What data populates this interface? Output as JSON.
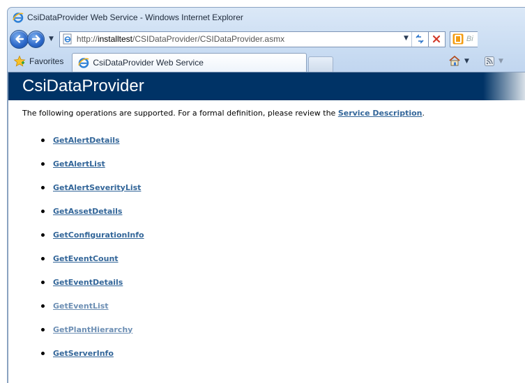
{
  "window": {
    "title": "CsiDataProvider Web Service - Windows Internet Explorer"
  },
  "address_bar": {
    "url_scheme": "http://",
    "url_host": "installtest",
    "url_path": "/CSIDataProvider/CSIDataProvider.asmx",
    "search_placeholder": "Bi"
  },
  "favorites_bar": {
    "favorites_label": "Favorites",
    "active_tab_label": "CsiDataProvider Web Service"
  },
  "page": {
    "title": "CsiDataProvider",
    "intro_text": "The following operations are supported. For a formal definition, please review the ",
    "service_description_link": "Service Description",
    "intro_suffix": ".",
    "operations": [
      {
        "name": "GetAlertDetails",
        "visited": false
      },
      {
        "name": "GetAlertList",
        "visited": false
      },
      {
        "name": "GetAlertSeverityList",
        "visited": false
      },
      {
        "name": "GetAssetDetails",
        "visited": false
      },
      {
        "name": "GetConfigurationInfo",
        "visited": false
      },
      {
        "name": "GetEventCount",
        "visited": false
      },
      {
        "name": "GetEventDetails",
        "visited": false
      },
      {
        "name": "GetEventList",
        "visited": true
      },
      {
        "name": "GetPlantHierarchy",
        "visited": true
      },
      {
        "name": "GetServerInfo",
        "visited": false
      }
    ]
  },
  "colors": {
    "header_band": "#003366",
    "link": "#336699",
    "visited_link": "#6d8fb4",
    "chrome_blue": "#c9dcf2"
  }
}
